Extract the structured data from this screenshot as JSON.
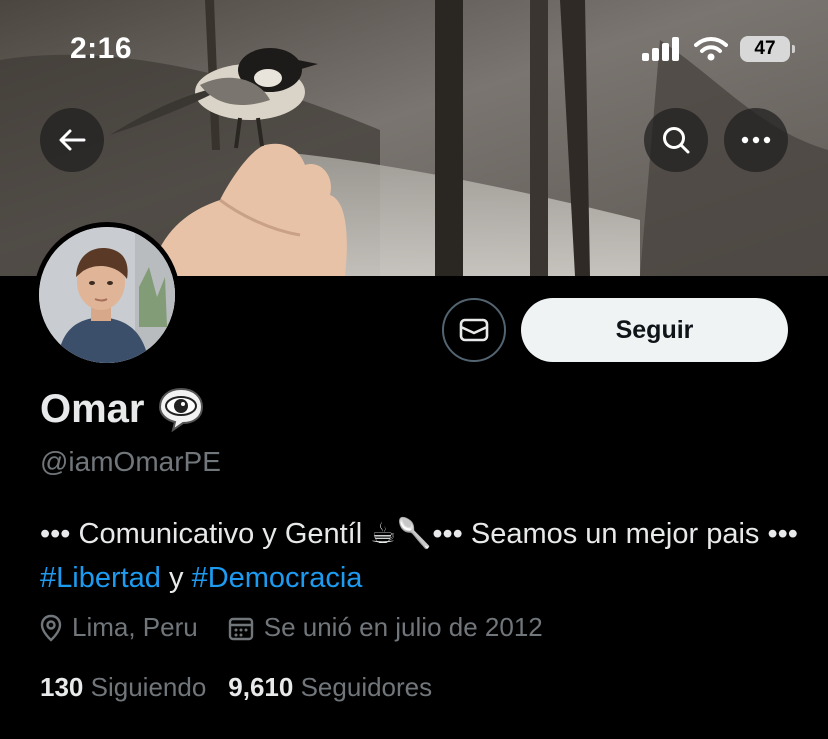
{
  "status_bar": {
    "time": "2:16",
    "battery": "47",
    "signal_icon": "cellular-signal-icon",
    "wifi_icon": "wifi-icon"
  },
  "header": {
    "back_icon": "back-arrow-icon",
    "search_icon": "search-icon",
    "more_icon": "more-options-icon"
  },
  "profile": {
    "name": "Omar",
    "name_emoji": "👁‍🗨",
    "handle": "@iamOmarPE",
    "bio": {
      "part1": "••• Comunicativo y Gentíl ☕🥄••• Seamos un mejor pais ••• ",
      "tag1": "#Libertad",
      "connector": " y ",
      "tag2": "#Democracia"
    },
    "location": "Lima, Peru",
    "joined": "Se unió en julio de 2012",
    "following_count": "130",
    "following_label": "Siguiendo",
    "followers_count": "9,610",
    "followers_label": "Seguidores"
  },
  "actions": {
    "message_icon": "envelope-icon",
    "follow_label": "Seguir"
  },
  "colors": {
    "background": "#000000",
    "accent": "#1d9bf0",
    "secondary_text": "#71767b",
    "follow_button_bg": "#eff3f4"
  }
}
